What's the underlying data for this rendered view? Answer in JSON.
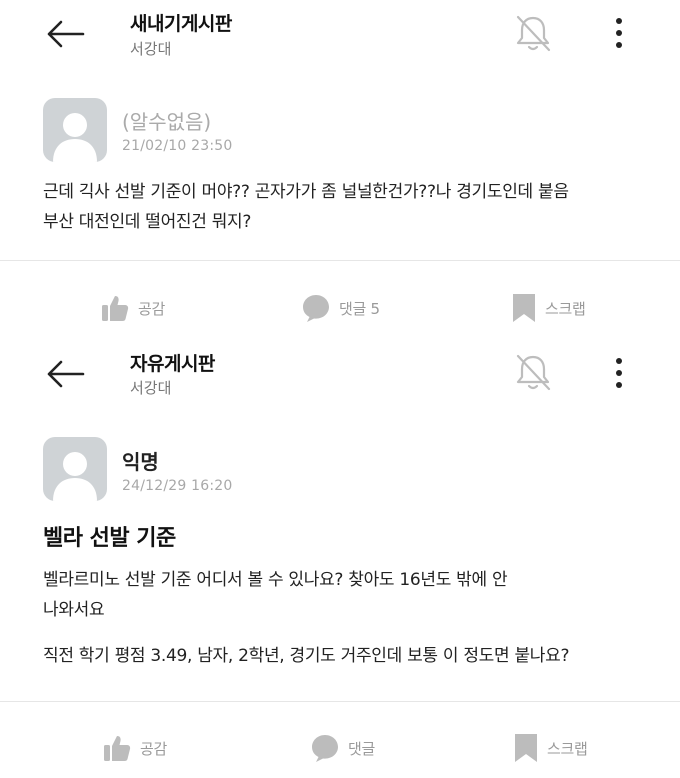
{
  "posts": [
    {
      "board_title": "새내기게시판",
      "school": "서강대",
      "author": "(알수없음)",
      "date": "21/02/10 23:50",
      "title": "",
      "body_lines": [
        "근데 긱사 선발 기준이 머야?? 곤자가가 좀 널널한건가??나 경기도인데 붙음",
        "부산 대전인데 떨어진건 뭐지?"
      ],
      "actions": {
        "like_label": "공감",
        "comment_label": "댓글 5",
        "scrap_label": "스크랩"
      }
    },
    {
      "board_title": "자유게시판",
      "school": "서강대",
      "author": "익명",
      "date": "24/12/29 16:20",
      "title": "벨라 선발 기준",
      "body_lines": [
        "벨라르미노 선발 기준 어디서 볼 수 있나요? 찾아도 16년도 밖에 안",
        "나와서요",
        "",
        "직전 학기 평점 3.49, 남자, 2학년, 경기도 거주인데 보통 이 정도면 붙나요?"
      ],
      "actions": {
        "like_label": "공감",
        "comment_label": "댓글",
        "scrap_label": "스크랩"
      }
    }
  ],
  "icons": {
    "back": "arrow-left-icon",
    "notification": "bell-off-icon",
    "more": "more-vertical-icon",
    "like": "thumbs-up-icon",
    "comment": "speech-bubble-icon",
    "scrap": "bookmark-icon"
  },
  "colors": {
    "icon_gray": "#b8b8b8",
    "avatar_bg": "#cfd3d6",
    "avatar_fg": "#ffffff",
    "meta_gray": "#a8a8a8"
  }
}
